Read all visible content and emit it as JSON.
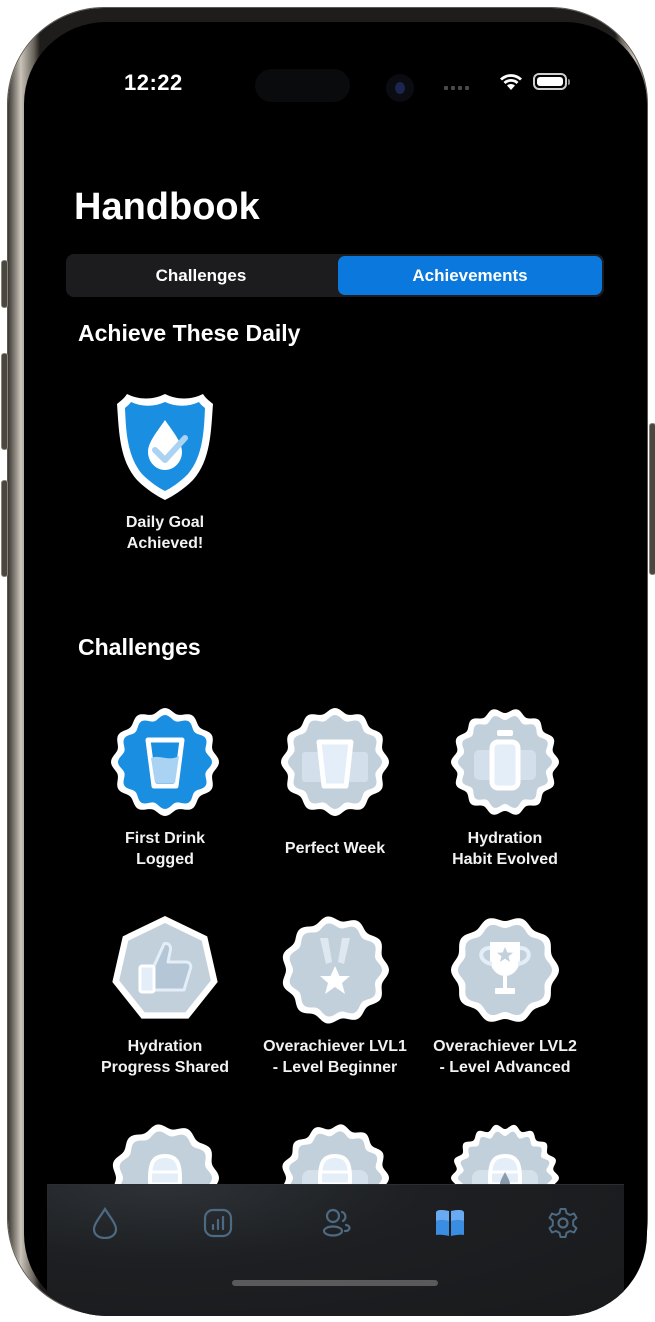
{
  "status_bar": {
    "time": "12:22",
    "wifi_icon": "wifi-icon",
    "battery_icon": "battery-icon",
    "battery_level_fraction": 1.0
  },
  "header": {
    "title": "Handbook"
  },
  "segmented_control": {
    "options": [
      "Challenges",
      "Achievements"
    ],
    "selected": "Achievements",
    "active_color": "#0a78dc"
  },
  "daily": {
    "title": "Achieve These Daily",
    "items": [
      {
        "label": "Daily Goal Achieved!",
        "icon": "shield-water-drop-check-icon",
        "unlocked": true
      }
    ]
  },
  "challenges": {
    "title": "Challenges",
    "items": [
      {
        "label": "First Drink Logged",
        "icon": "water-glass-icon",
        "unlocked": true
      },
      {
        "label": "Perfect Week",
        "icon": "three-glasses-icon",
        "unlocked": false
      },
      {
        "label": "Hydration Habit Evolved",
        "icon": "three-bottles-icon",
        "unlocked": false
      },
      {
        "label": "Hydration Progress Shared",
        "icon": "thumbs-up-icon",
        "unlocked": false
      },
      {
        "label": "Overachiever LVL1 - Level Beginner",
        "icon": "medal-star-icon",
        "unlocked": false
      },
      {
        "label": "Overachiever LVL2 - Level Advanced",
        "icon": "trophy-star-icon",
        "unlocked": false
      },
      {
        "label": "",
        "icon": "water-barrel-icon",
        "unlocked": false
      },
      {
        "label": "",
        "icon": "water-barrels-icon",
        "unlocked": false
      },
      {
        "label": "",
        "icon": "water-barrel-drop-icon",
        "unlocked": false
      }
    ]
  },
  "colors": {
    "unlocked_badge": "#1a8ee0",
    "locked_badge": "#c2d0dc",
    "tab_inactive": "#4d6a82",
    "tab_active": "#3a8de0"
  },
  "tab_bar": {
    "tabs": [
      {
        "name": "hydration",
        "icon": "water-drop-icon",
        "active": false
      },
      {
        "name": "statistics",
        "icon": "bar-chart-icon",
        "active": false
      },
      {
        "name": "social",
        "icon": "people-icon",
        "active": false
      },
      {
        "name": "handbook",
        "icon": "book-icon",
        "active": true
      },
      {
        "name": "settings",
        "icon": "gear-icon",
        "active": false
      }
    ]
  }
}
